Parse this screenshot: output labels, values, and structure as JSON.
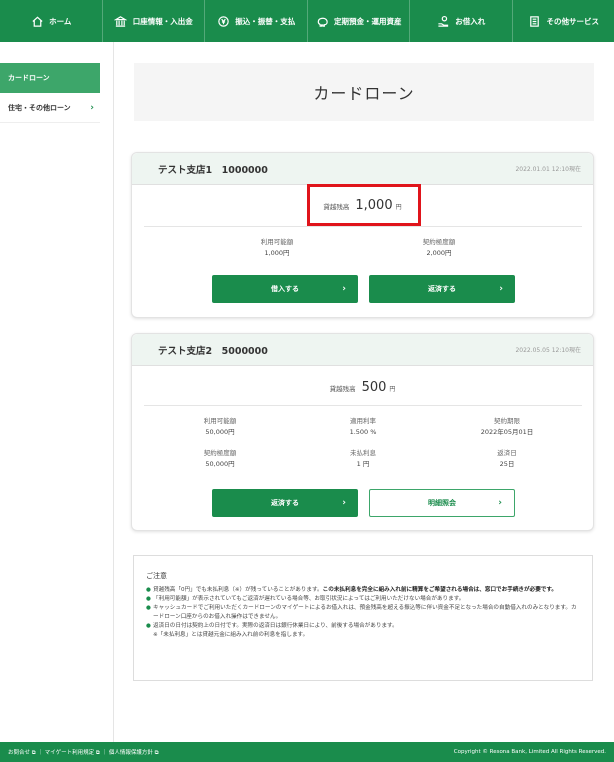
{
  "nav": {
    "home": "ホーム",
    "account": "口座情報・入出金",
    "transfer": "振込・振替・支払",
    "deposit": "定期預金・運用資産",
    "loan": "お借入れ",
    "other": "その他サービス"
  },
  "sidebar": {
    "items": [
      {
        "label": "カードローン"
      },
      {
        "label": "住宅・その他ローン"
      }
    ]
  },
  "page": {
    "title": "カードローン"
  },
  "card1": {
    "name": "テスト支店1　1000000",
    "timestamp": "2022.01.01 12:10現在",
    "balance_label": "貸越残高",
    "balance_value": "1,000",
    "balance_unit": "円",
    "available_label": "利用可能額",
    "available_value": "1,000円",
    "limit_label": "契約極度額",
    "limit_value": "2,000円",
    "borrow_button": "借入する",
    "repay_button": "返済する"
  },
  "card2": {
    "name": "テスト支店2　5000000",
    "timestamp": "2022.05.05 12:10現在",
    "balance_label": "貸越残高",
    "balance_value": "500",
    "balance_unit": "円",
    "available_label": "利用可能額",
    "available_value": "50,000円",
    "rate_label": "適用利率",
    "rate_value": "1.500 %",
    "expiry_label": "契約期限",
    "expiry_value": "2022年05月01日",
    "limit_label": "契約極度額",
    "limit_value": "50,000円",
    "unpaid_label": "未払利息",
    "unpaid_value": "1 円",
    "repay_day_label": "返済日",
    "repay_day_value": "25日",
    "repay_button": "返済する",
    "detail_button": "明細照会"
  },
  "notes": {
    "title": "ご注意",
    "n1_plain": "貸越残高「0円」でも未払利息（※）が残っていることがあります。",
    "n1_bold": "この未払利息を完全に組み入れ前に精算をご希望される場合は、窓口でお手続きが必要です。",
    "n2": "「利用可能額」が表示されていてもご返済が遅れている場合等、お取引状況によってはご利用いただけない場合があります。",
    "n3": "キャッシュカードでご利用いただくカードローンのマイゲートによるお借入れは、預金残高を超える振込等に伴い資金不足となった場合の自動借入れのみとなります。カードローン口座からのお借入れ操作はできません。",
    "n4": "返済日の日付は契約上の日付です。実際の返済日は銀行休業日により、前後する場合があります。",
    "n5": "※「未払利息」とは貸越元金に組み入れ前の利息を指します。"
  },
  "footer": {
    "links": "お問合せ ⧉ ｜ マイゲート利用規定 ⧉ ｜ 個人情報保護方針 ⧉",
    "copyright": "Copyright © Resona Bank, Limited All Rights Reserved."
  },
  "colors": {
    "brand": "#1a8c4c",
    "highlight": "#e0141b"
  }
}
